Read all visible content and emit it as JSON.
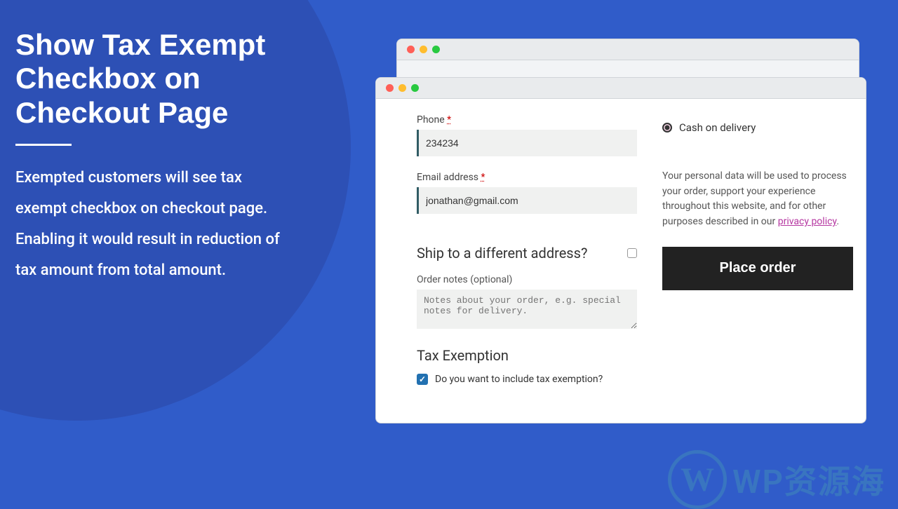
{
  "promo": {
    "title": "Show Tax Exempt Checkbox on Checkout Page",
    "description": "Exempted customers will see tax exempt checkbox on checkout page. Enabling it would result in reduction of tax amount from total amount."
  },
  "checkout": {
    "phone_label": "Phone",
    "phone_value": "234234",
    "email_label": "Email address",
    "email_value": "jonathan@gmail.com",
    "required_mark": "*",
    "ship_title": "Ship to a different address?",
    "notes_label": "Order notes (optional)",
    "notes_placeholder": "Notes about your order, e.g. special notes for delivery.",
    "tax_section_title": "Tax Exemption",
    "tax_checkbox_label": "Do you want to include tax exemption?",
    "payment_option": "Cash on delivery",
    "privacy_text": "Your personal data will be used to process your order, support your experience throughout this website, and for other purposes described in our ",
    "privacy_link_text": "privacy policy",
    "privacy_suffix": ".",
    "place_order_label": "Place order"
  },
  "watermark_text": "WP资源海",
  "watermark_letter": "W"
}
